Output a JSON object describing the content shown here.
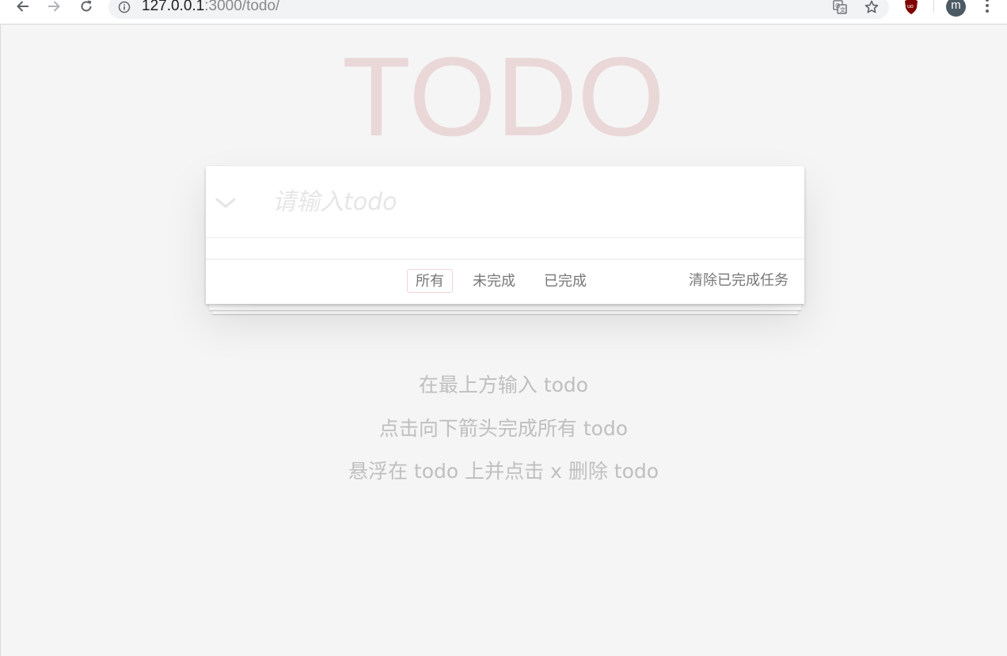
{
  "browser": {
    "url_host": "127.0.0.1",
    "url_rest": ":3000/todo/",
    "avatar_letter": "m",
    "icons": [
      "back-arrow-icon",
      "forward-arrow-icon",
      "reload-icon",
      "info-icon",
      "translate-icon",
      "star-icon",
      "ublock-icon",
      "menu-dots-icon"
    ]
  },
  "app": {
    "title": "TODO",
    "input_placeholder": "请输入todo",
    "toggle_icon": "chevron-down-icon",
    "filters": [
      {
        "label": "所有",
        "selected": true
      },
      {
        "label": "未完成",
        "selected": false
      },
      {
        "label": "已完成",
        "selected": false
      }
    ],
    "clear_completed_label": "清除已完成任务"
  },
  "info": {
    "lines": [
      "在最上方输入 todo",
      "点击向下箭头完成所有 todo",
      "悬浮在 todo 上并点击 x 删除 todo"
    ]
  },
  "colors": {
    "title": "#eacfcf",
    "background": "#f5f5f5",
    "selected_filter_border": "#efd5d5",
    "info_text": "#bfbfbf"
  }
}
